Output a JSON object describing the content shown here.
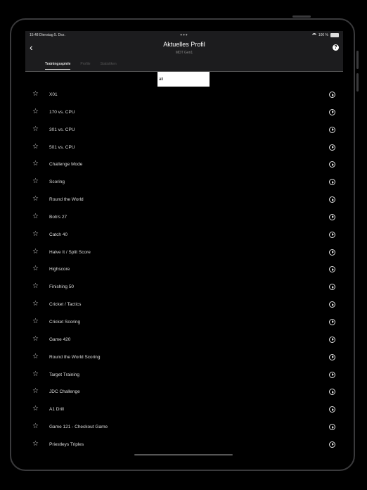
{
  "status": {
    "time": "15:48",
    "date": "Dienstag 5. Dez.",
    "battery": "100 %"
  },
  "header": {
    "title": "Aktuelles Profil",
    "subtitle": "MDT Gen1",
    "help_label": "?"
  },
  "tabs": [
    {
      "label": "Trainingsspiele",
      "active": true
    },
    {
      "label": "Profile",
      "active": false
    },
    {
      "label": "Statistiken",
      "active": false
    }
  ],
  "search": {
    "value": "all",
    "placeholder": ""
  },
  "games": [
    "X01",
    "170 vs. CPU",
    "301 vs. CPU",
    "501 vs. CPU",
    "Challenge Mode",
    "Scoring",
    "Round the World",
    "Bob's 27",
    "Catch 40",
    "Halve It / Split Score",
    "Highscore",
    "Finishing 50",
    "Cricket / Tactics",
    "Cricket Scoring",
    "Game 420",
    "Round the World Scoring",
    "Target Training",
    "JDC Challenge",
    "A1 Drill",
    "Game 121 - Checkout Game",
    "Priestleys Triples"
  ]
}
